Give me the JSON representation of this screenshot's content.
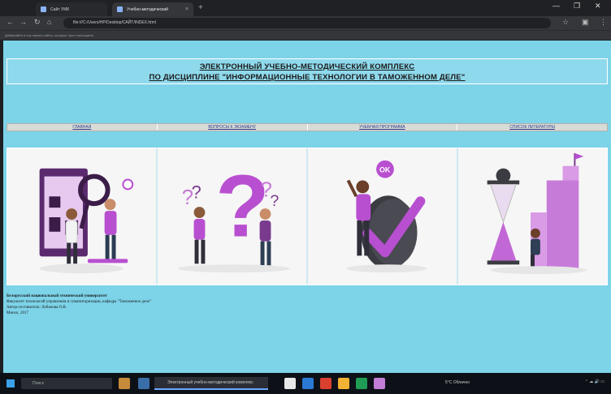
{
  "browser": {
    "tabs": [
      {
        "title": "Сайт УМК"
      },
      {
        "title": "Учебно-методический"
      }
    ],
    "address": "file:///C:/Users/HP/Desktop/САЙТ/INDEX.html",
    "bookmarks_hint": "Добавляйте в эту панель сайты, которые часто посещаете."
  },
  "header": {
    "line1": "ЭЛЕКТРОННЫЙ УЧЕБНО-МЕТОДИЧЕСКИЙ КОМПЛЕКС",
    "line2": "ПО ДИСЦИПЛИНЕ \"ИНФОРМАЦИОННЫЕ ТЕХНОЛОГИИ В ТАМОЖЕННОМ ДЕЛЕ\""
  },
  "nav": {
    "items": [
      "ГЛАВНАЯ",
      "ВОПРОСЫ К ЭКЗАМЕНУ",
      "УЧЕБНАЯ ПРОГРАММА",
      "СПИСОК ЛИТЕРАТУРЫ"
    ]
  },
  "gallery": {
    "images": [
      "research-illustration",
      "questions-illustration",
      "ok-checkmark-illustration",
      "hourglass-progress-illustration"
    ],
    "accent": "#b84fd0"
  },
  "footer": {
    "university": "Белорусский национальный технический университет",
    "faculty": "Факультет технологий управления и гуманитаризации, кафедра \"Таможенное дело\"",
    "author": "Автор-составитель: Лобанова О.В.",
    "city_year": "Минск, 2017"
  },
  "taskbar": {
    "search": "Поиск",
    "active_window": "Электронный учебно-методический комплекс",
    "weather": "5°C Облачно"
  }
}
